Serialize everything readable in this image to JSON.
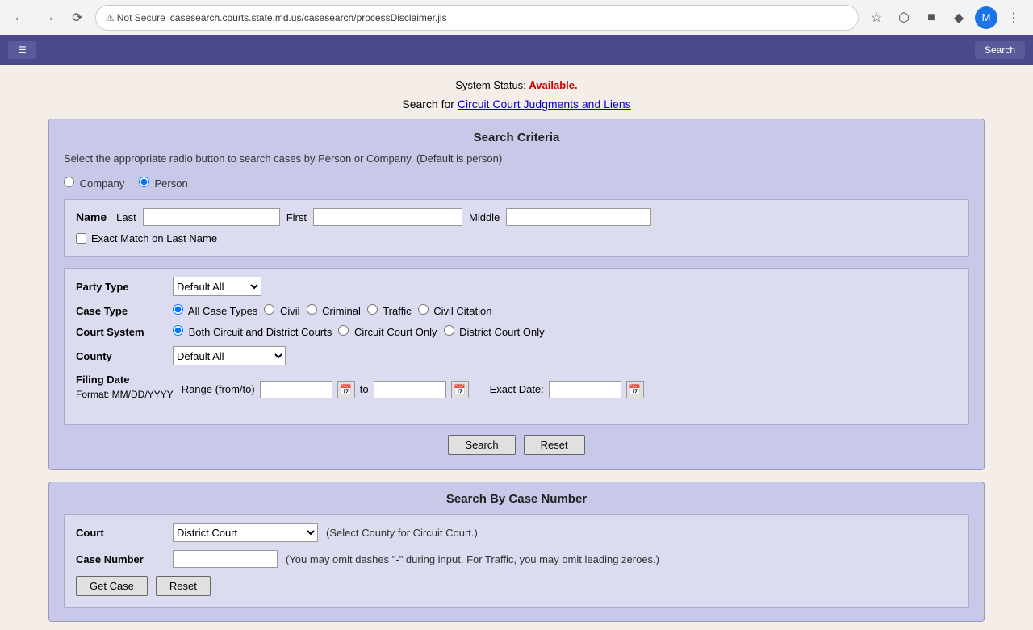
{
  "browser": {
    "not_secure_label": "Not Secure",
    "url": "casesearch.courts.state.md.us/casesearch/processDisclaimer.jis",
    "avatar_initial": "M"
  },
  "top_bar": {
    "left_label": "☰",
    "right_label": "Search"
  },
  "page": {
    "system_status_label": "System Status:",
    "system_status_value": "Available.",
    "circuit_link_prefix": "Search for ",
    "circuit_link_text": "Circuit Court Judgments and Liens"
  },
  "search_criteria": {
    "title": "Search Criteria",
    "radio_description": "Select the appropriate radio button to search cases by Person or Company. (Default is person)",
    "company_label": "Company",
    "person_label": "Person",
    "name_label": "Name",
    "last_label": "Last",
    "first_label": "First",
    "middle_label": "Middle",
    "exact_match_label": "Exact Match on Last Name",
    "party_type_label": "Party Type",
    "party_type_default": "Default All",
    "case_type_label": "Case Type",
    "case_type_options": [
      "All Case Types",
      "Civil",
      "Criminal",
      "Traffic",
      "Civil Citation"
    ],
    "court_system_label": "Court System",
    "court_system_options": [
      "Both Circuit and District Courts",
      "Circuit Court Only",
      "District Court Only"
    ],
    "county_label": "County",
    "county_default": "Default All",
    "filing_date_label": "Filing Date",
    "filing_date_format": "Format: MM/DD/YYYY",
    "range_label": "Range (from/to)",
    "to_label": "to",
    "exact_date_label": "Exact Date:",
    "search_btn": "Search",
    "reset_btn": "Reset"
  },
  "case_number": {
    "title": "Search By Case Number",
    "court_label": "Court",
    "court_value": "District Court",
    "court_hint": "(Select County for Circuit Court.)",
    "case_number_label": "Case Number",
    "case_number_hint": "(You may omit dashes \"-\" during input. For Traffic, you may omit leading zeroes.)",
    "get_case_btn": "Get Case",
    "reset_btn": "Reset"
  }
}
